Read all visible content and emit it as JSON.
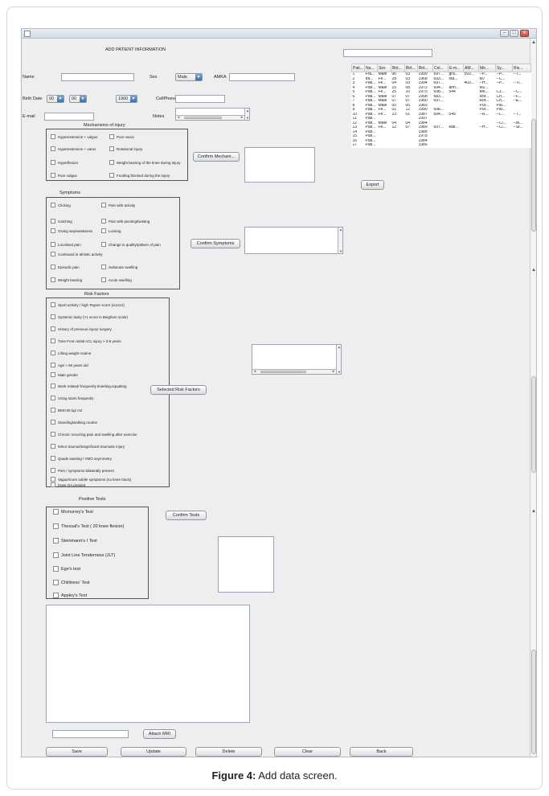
{
  "window": {
    "buttons": {
      "minimize": "–",
      "maximize": "□",
      "close": "x"
    }
  },
  "form": {
    "heading": "ADD PATIENT INFORMATION",
    "name_label": "Name",
    "sex_label": "Sex",
    "sex_value": "Male",
    "amka_label": "AMKA",
    "birth_label": "Birth Date",
    "birth_day": "00",
    "birth_month": "00",
    "birth_year": "1900",
    "cellphone_label": "CellPhone",
    "email_label": "E-mail",
    "notes_label": "Notes"
  },
  "mechanisms": {
    "title": "Mechanisms of injury",
    "items": [
      "Hyperextension + valgus",
      "Pure varus",
      "Hyperextension + varus",
      "Rotational injury",
      "Hyperflexion",
      "Weight bearing of the knee during injury",
      "Pure valgus",
      "Foot/leg blocked during the injury"
    ],
    "confirm_button": "Confirm Mechani..."
  },
  "symptoms": {
    "title": "Symptoms",
    "items": [
      "Clicking",
      "Pain with activity",
      "Catching",
      "Pain with pivoting/twisting",
      "Giving way/weakness",
      "Locking",
      "Localised pain",
      "Change in quality/pattern of pain",
      "Continued in all-letic activity",
      "Episodic pain",
      "Subacute swelling",
      "Weight bearing",
      "Acute swelling"
    ],
    "confirm_button": "Confirm Symptoms"
  },
  "risk": {
    "title": "Risk Factors",
    "items": [
      "Sport activity / high Tegner score (soccer)",
      "Systemic laxity (>1 score in Beighton scale)",
      "History of previous injury/ surgery",
      "Time From initial ACL injury > 3-5 years",
      "Lifting weight routine",
      "Age > 60 years old",
      "Male gender",
      "Work related/ frequently kneeling-squatting",
      "Using stairs frequently",
      "BMI>25 kg/ m2",
      "Standing/walking routine",
      "Chronic recurring pain and swelling after exercise",
      "Minor trauma/insignificant traumatic injury",
      "Quads wasting / VMO asymmetry",
      "Pain / symptoms bilaterally present",
      "Vague/more subtle symptoms (no knee block)",
      "Knee OA present"
    ],
    "selected_button": "Selected Risk Factors"
  },
  "tests": {
    "title": "Positive Tests",
    "items": [
      "Mcmurrey's Test",
      "Thessal's Test ( 20 knee flexion)",
      "Steinmann's I Test",
      "Joint Line Tenderness (JLT)",
      "Ege's test",
      "Childress' Test",
      "Appley's Test"
    ],
    "confirm_button": "Confirm Tests"
  },
  "patients_table": {
    "columns": [
      "Pati...",
      "Na...",
      "Sex",
      "Birt...",
      "Birt...",
      "Birt...",
      "Cel...",
      "E-m...",
      "AM...",
      "Me...",
      "Sy...",
      "Ris..."
    ],
    "rows": [
      [
        "1",
        "Fra...",
        "Male",
        "06",
        "03",
        "1999",
        "697...",
        "gra...",
        "593...",
        "--P...",
        "--P...",
        "--T..."
      ],
      [
        "2",
        "Ira...",
        "Fe...",
        "28",
        "03",
        "1968",
        "693...",
        "sta...",
        "",
        "M7",
        "--C...",
        ""
      ],
      [
        "3",
        "Pati...",
        "Fe...",
        "04",
        "03",
        "1994",
        "697...",
        "",
        "403...",
        "--H...",
        "--P...",
        "--Ti..."
      ],
      [
        "4",
        "Pati...",
        "Male",
        "15",
        "08",
        "1973",
        "694...",
        "ann...",
        "",
        "M2...",
        "",
        ""
      ],
      [
        "5",
        "Pati...",
        "Fe...",
        "25",
        "10",
        "1975",
        "698...",
        "544",
        "",
        "M6...",
        "C1...",
        "--C..."
      ],
      [
        "6",
        "Pati...",
        "Male",
        "07",
        "07",
        "1958",
        "683...",
        "",
        "",
        "Rot...",
        "Ch...",
        "--F..."
      ],
      [
        "7",
        "Pati...",
        "Male",
        "07",
        "07",
        "1980",
        "697...",
        "",
        "",
        "Rot...",
        "Ch...",
        "--E..."
      ],
      [
        "8",
        "Pati...",
        "Male",
        "05",
        "05",
        "1983",
        "",
        "",
        "",
        "Pur...",
        "Pai...",
        ""
      ],
      [
        "9",
        "Pati...",
        "Fe...",
        "01",
        "12",
        "1990",
        "698...",
        "",
        "",
        "Pur...",
        "Pai...",
        ""
      ],
      [
        "10",
        "Pati...",
        "Fe...",
        "23",
        "01",
        "1987",
        "694...",
        "545",
        "",
        "--R...",
        "--L...",
        "--T..."
      ],
      [
        "11",
        "Pati...",
        "",
        "",
        "",
        "1997",
        "",
        "",
        "",
        "",
        "",
        ""
      ],
      [
        "12",
        "Pati...",
        "Male",
        "04",
        "04",
        "1984",
        "",
        "",
        "",
        "",
        "--Cl...",
        "--M..."
      ],
      [
        "13",
        "Pati...",
        "Fe...",
        "12",
        "07",
        "1989",
        "697...",
        "kati...",
        "",
        "--H...",
        "--Cl...",
        "--St..."
      ],
      [
        "14",
        "Pati...",
        "",
        "",
        "",
        "1988",
        "",
        "",
        "",
        "",
        "",
        ""
      ],
      [
        "15",
        "Pati...",
        "",
        "",
        "",
        "1978",
        "",
        "",
        "",
        "",
        "",
        ""
      ],
      [
        "16",
        "Pati...",
        "",
        "",
        "",
        "1984",
        "",
        "",
        "",
        "",
        "",
        ""
      ],
      [
        "17",
        "Pati...",
        "",
        "",
        "",
        "1986",
        "",
        "",
        "",
        "",
        "",
        ""
      ]
    ],
    "export_button": "Export"
  },
  "mri": {
    "attach_button": "Attach MRI"
  },
  "actions": {
    "save": "Save",
    "update": "Update",
    "delete": "Delete",
    "clear": "Clear",
    "back": "Back"
  },
  "caption": {
    "bold": "Figure 4:",
    "text": " Add data screen."
  }
}
